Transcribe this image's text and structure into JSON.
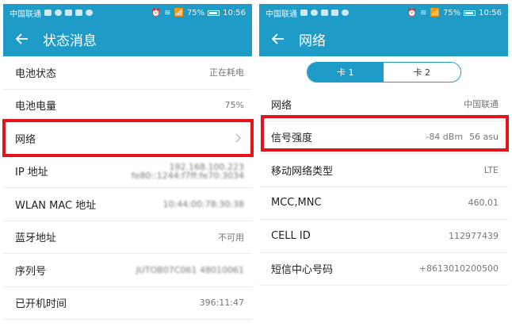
{
  "status_bar": {
    "carrier": "中国联通",
    "battery": "75%",
    "time": "10:56"
  },
  "left_screen": {
    "title": "状态消息",
    "rows": [
      {
        "label": "电池状态",
        "value": "正在耗电"
      },
      {
        "label": "电池电量",
        "value": "75%"
      },
      {
        "label": "网络",
        "value": ""
      },
      {
        "label": "IP 地址",
        "value": "192.168.100.223",
        "value2": "fe80::1244:f7ff:fe70:3034"
      },
      {
        "label": "WLAN MAC 地址",
        "value": "10:44:00:78:30:38"
      },
      {
        "label": "蓝牙地址",
        "value": "不可用"
      },
      {
        "label": "序列号",
        "value": "JUTOB07C061 48010061"
      },
      {
        "label": "已开机时间",
        "value": "396:11:47"
      }
    ]
  },
  "right_screen": {
    "title": "网络",
    "tabs": [
      {
        "label": "卡 1",
        "active": true
      },
      {
        "label": "卡 2",
        "active": false
      }
    ],
    "rows": [
      {
        "label": "网络",
        "value": "中国联通"
      },
      {
        "label": "信号强度",
        "value": "-84 dBm",
        "value2": "56 asu"
      },
      {
        "label": "移动网络类型",
        "value": "LTE"
      },
      {
        "label": "MCC,MNC",
        "value": "460,01"
      },
      {
        "label": "CELL ID",
        "value": "112977439"
      },
      {
        "label": "短信中心号码",
        "value": "+8613010200500"
      }
    ]
  },
  "colors": {
    "primary": "#1e9bc7",
    "highlight": "#e4141b"
  }
}
